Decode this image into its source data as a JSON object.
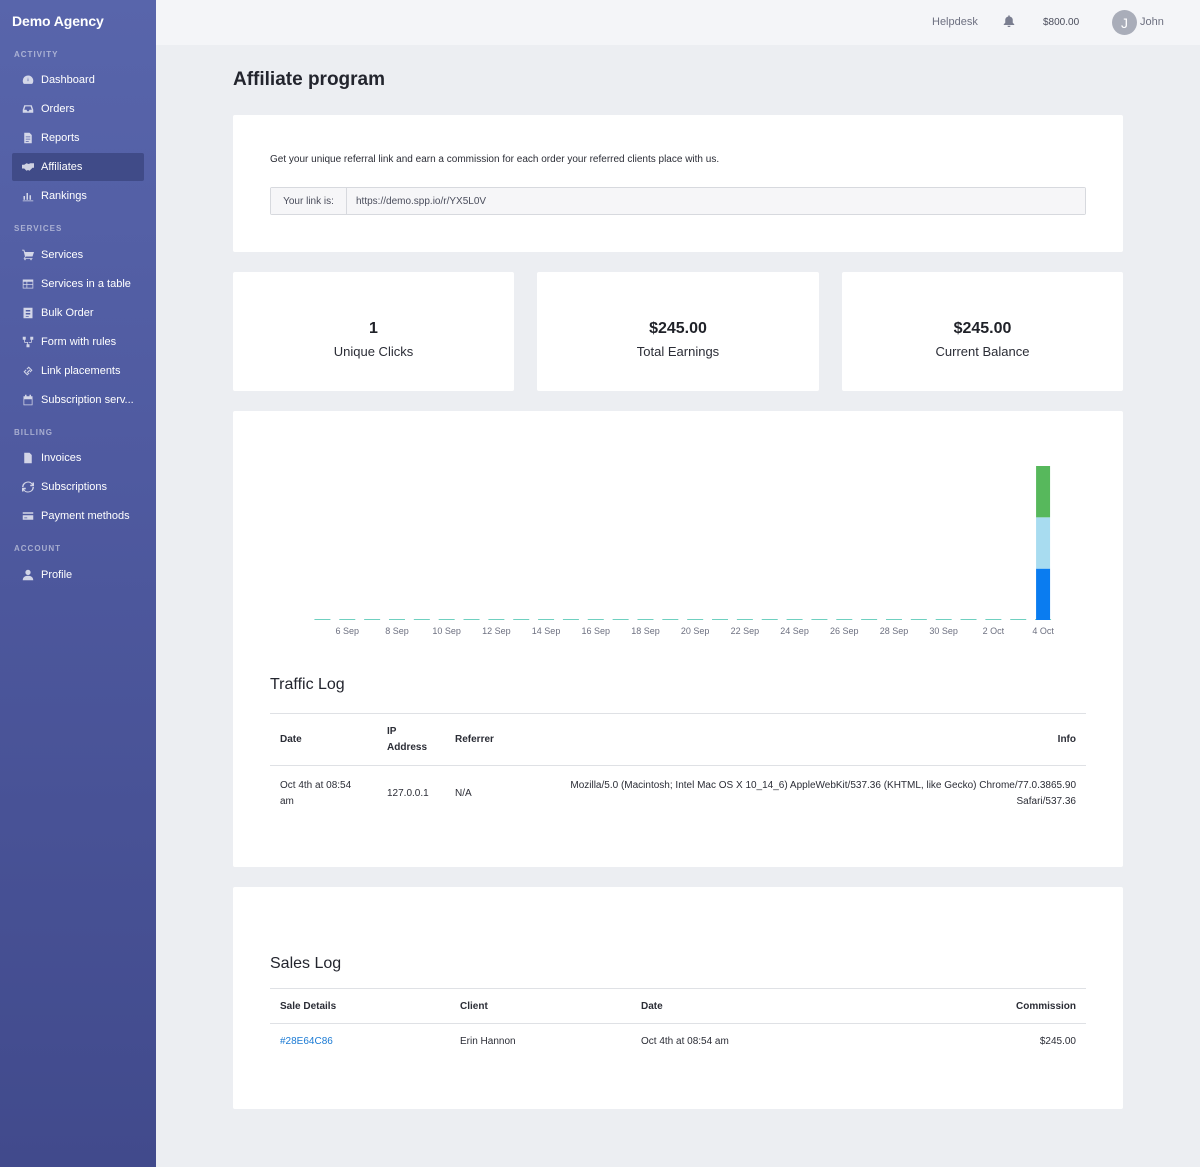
{
  "sidebar": {
    "brand": "Demo Agency",
    "sections": {
      "activity": "ACTIVITY",
      "services": "SERVICES",
      "billing": "BILLING",
      "account": "ACCOUNT"
    },
    "items": [
      {
        "label": "Dashboard",
        "icon": "dashboard-icon"
      },
      {
        "label": "Orders",
        "icon": "inbox-icon"
      },
      {
        "label": "Reports",
        "icon": "report-icon"
      },
      {
        "label": "Affiliates",
        "icon": "handshake-icon",
        "active": true
      },
      {
        "label": "Rankings",
        "icon": "bar-chart-icon"
      },
      {
        "label": "Services",
        "icon": "cart-icon"
      },
      {
        "label": "Services in a table",
        "icon": "table-icon"
      },
      {
        "label": "Bulk Order",
        "icon": "bulk-order-icon"
      },
      {
        "label": "Form with rules",
        "icon": "flow-icon"
      },
      {
        "label": "Link placements",
        "icon": "link-icon"
      },
      {
        "label": "Subscription serv...",
        "icon": "calendar-icon"
      },
      {
        "label": "Invoices",
        "icon": "file-icon"
      },
      {
        "label": "Subscriptions",
        "icon": "refresh-icon"
      },
      {
        "label": "Payment methods",
        "icon": "credit-card-icon"
      },
      {
        "label": "Profile",
        "icon": "user-icon"
      }
    ]
  },
  "topbar": {
    "helpdesk": "Helpdesk",
    "balance": "$800.00",
    "avatar_initial": "J",
    "user_name": "John"
  },
  "page": {
    "title": "Affiliate program"
  },
  "referral": {
    "intro": "Get your unique referral link and earn a commission for each order your referred clients place with us.",
    "link_label": "Your link is:",
    "link_value": "https://demo.spp.io/r/YX5L0V"
  },
  "stats": [
    {
      "value": "1",
      "label": "Unique Clicks"
    },
    {
      "value": "$245.00",
      "label": "Total Earnings"
    },
    {
      "value": "$245.00",
      "label": "Current Balance"
    }
  ],
  "chart_data": {
    "type": "bar",
    "stacked": true,
    "categories": [
      "5 Sep",
      "6 Sep",
      "7 Sep",
      "8 Sep",
      "9 Sep",
      "10 Sep",
      "11 Sep",
      "12 Sep",
      "13 Sep",
      "14 Sep",
      "15 Sep",
      "16 Sep",
      "17 Sep",
      "18 Sep",
      "19 Sep",
      "20 Sep",
      "21 Sep",
      "22 Sep",
      "23 Sep",
      "24 Sep",
      "25 Sep",
      "26 Sep",
      "27 Sep",
      "28 Sep",
      "29 Sep",
      "30 Sep",
      "1 Oct",
      "2 Oct",
      "3 Oct",
      "4 Oct"
    ],
    "tick_labels": [
      "6 Sep",
      "8 Sep",
      "10 Sep",
      "12 Sep",
      "14 Sep",
      "16 Sep",
      "18 Sep",
      "20 Sep",
      "22 Sep",
      "24 Sep",
      "26 Sep",
      "28 Sep",
      "30 Sep",
      "2 Oct",
      "4 Oct"
    ],
    "series": [
      {
        "color": "#0a7cf0",
        "values": [
          0,
          0,
          0,
          0,
          0,
          0,
          0,
          0,
          0,
          0,
          0,
          0,
          0,
          0,
          0,
          0,
          0,
          0,
          0,
          0,
          0,
          0,
          0,
          0,
          0,
          0,
          0,
          0,
          0,
          1
        ]
      },
      {
        "color": "#a8dcf0",
        "values": [
          0,
          0,
          0,
          0,
          0,
          0,
          0,
          0,
          0,
          0,
          0,
          0,
          0,
          0,
          0,
          0,
          0,
          0,
          0,
          0,
          0,
          0,
          0,
          0,
          0,
          0,
          0,
          0,
          0,
          1
        ]
      },
      {
        "color": "#57b85c",
        "values": [
          0,
          0,
          0,
          0,
          0,
          0,
          0,
          0,
          0,
          0,
          0,
          0,
          0,
          0,
          0,
          0,
          0,
          0,
          0,
          0,
          0,
          0,
          0,
          0,
          0,
          0,
          0,
          0,
          0,
          1
        ]
      }
    ],
    "baseline_color": "#6fd0c0",
    "ylim": [
      0,
      3
    ],
    "grid": false,
    "title": "",
    "xlabel": "",
    "ylabel": ""
  },
  "traffic": {
    "heading": "Traffic Log",
    "columns": [
      "Date",
      "IP Address",
      "Referrer",
      "Info"
    ],
    "rows": [
      {
        "date": "Oct 4th at 08:54 am",
        "ip": "127.0.0.1",
        "referrer": "N/A",
        "info": "Mozilla/5.0 (Macintosh; Intel Mac OS X 10_14_6) AppleWebKit/537.36 (KHTML, like Gecko) Chrome/77.0.3865.90 Safari/537.36"
      }
    ]
  },
  "sales": {
    "heading": "Sales Log",
    "columns": [
      "Sale Details",
      "Client",
      "Date",
      "Commission"
    ],
    "rows": [
      {
        "id": "#28E64C86",
        "client": "Erin Hannon",
        "date": "Oct 4th at 08:54 am",
        "commission": "$245.00"
      }
    ]
  }
}
